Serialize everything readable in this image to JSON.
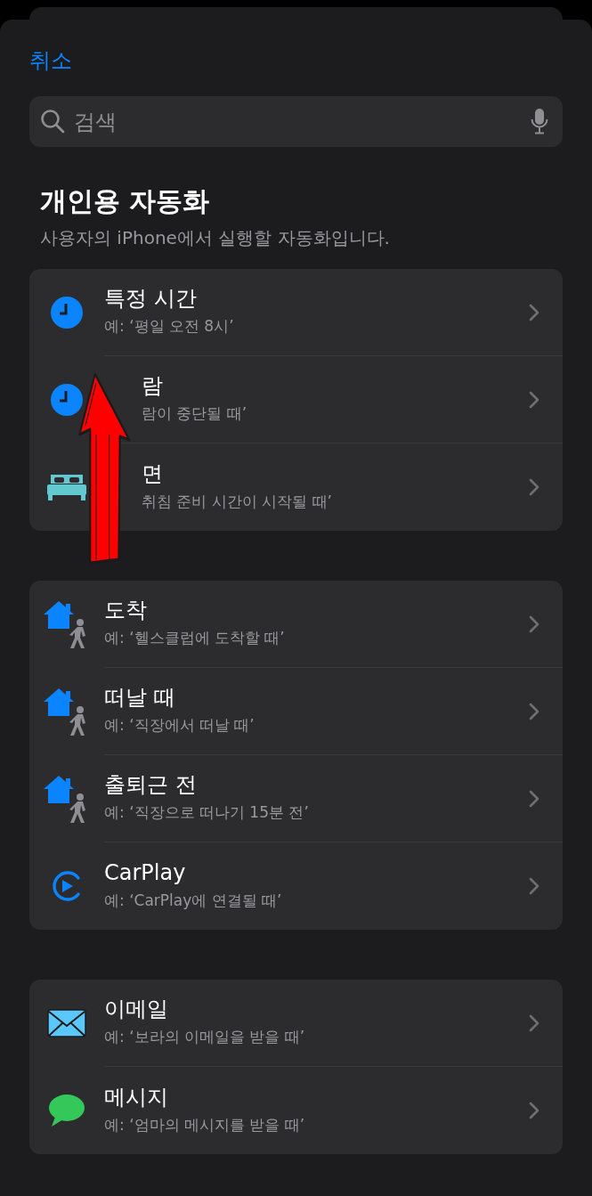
{
  "cancel": "취소",
  "search": {
    "placeholder": "검색"
  },
  "section": {
    "title": "개인용 자동화",
    "subtitle": "사용자의 iPhone에서 실행할 자동화입니다."
  },
  "groups": [
    {
      "rows": [
        {
          "kind": "clock",
          "title": "특정 시간",
          "subtitle": "예: ‘평일 오전 8시’",
          "partly_hidden": false
        },
        {
          "kind": "clock",
          "title": "람",
          "subtitle": "람이 중단될 때’",
          "partly_hidden": true
        },
        {
          "kind": "bed",
          "title": "면",
          "subtitle": "취침 준비 시간이 시작될 때’",
          "partly_hidden": true
        }
      ]
    },
    {
      "rows": [
        {
          "kind": "location",
          "title": "도착",
          "subtitle": "예: ‘헬스클럽에 도착할 때’",
          "partly_hidden": false
        },
        {
          "kind": "location",
          "title": "떠날 때",
          "subtitle": "예: ‘직장에서 떠날 때’",
          "partly_hidden": false
        },
        {
          "kind": "location",
          "title": "출퇴근 전",
          "subtitle": "예: ‘직장으로 떠나기 15분 전’",
          "partly_hidden": false
        },
        {
          "kind": "carplay",
          "title": "CarPlay",
          "subtitle": "예: ‘CarPlay에 연결될 때’",
          "partly_hidden": false
        }
      ]
    },
    {
      "rows": [
        {
          "kind": "email",
          "title": "이메일",
          "subtitle": "예: ‘보라의 이메일을 받을 때’",
          "partly_hidden": false
        },
        {
          "kind": "message",
          "title": "메시지",
          "subtitle": "예: ‘엄마의 메시지를 받을 때’",
          "partly_hidden": false
        }
      ]
    }
  ],
  "annotation": {
    "kind": "arrow",
    "color": "#ff0000"
  }
}
